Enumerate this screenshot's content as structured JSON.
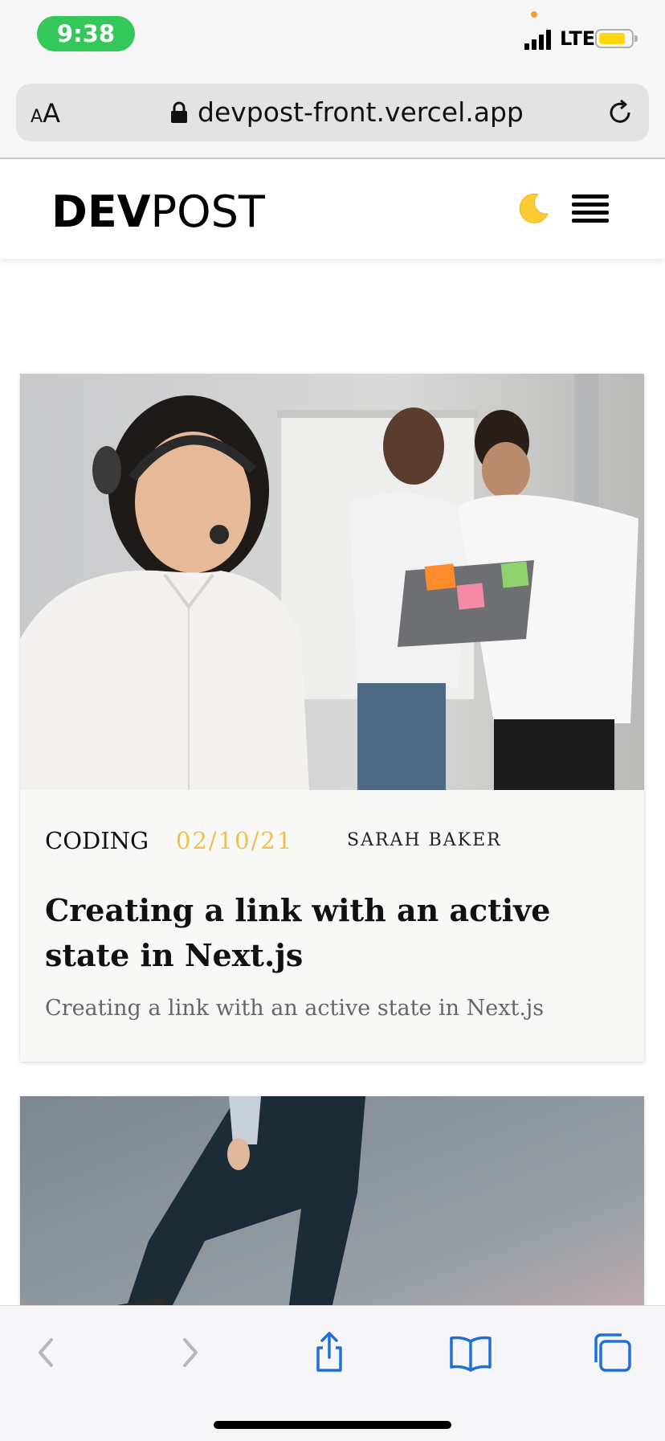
{
  "status_bar": {
    "time": "9:38",
    "network": "LTE",
    "colors": {
      "time_pill": "#34c759",
      "battery": "#ffd60a"
    }
  },
  "browser": {
    "text_size_label": "AA",
    "url": "devpost-front.vercel.app",
    "icons": [
      "lock-icon",
      "reload-icon"
    ]
  },
  "site_header": {
    "logo_bold": "DEV",
    "logo_light": "POST",
    "icons": [
      "moon-icon",
      "menu-icon"
    ]
  },
  "posts": [
    {
      "category": "CODING",
      "date": "02/10/21",
      "author": "SARAH BAKER",
      "title": "Creating a link with an active state in Next.js",
      "excerpt": "Creating a link with an active state in Next.js",
      "image": "photo of woman with headset smiling, two colleagues looking at laptop in background"
    }
  ],
  "toolbar": {
    "icons": [
      "back-icon",
      "forward-icon",
      "share-icon",
      "bookmarks-icon",
      "tabs-icon"
    ],
    "accent_color": "#1f6fd6"
  }
}
